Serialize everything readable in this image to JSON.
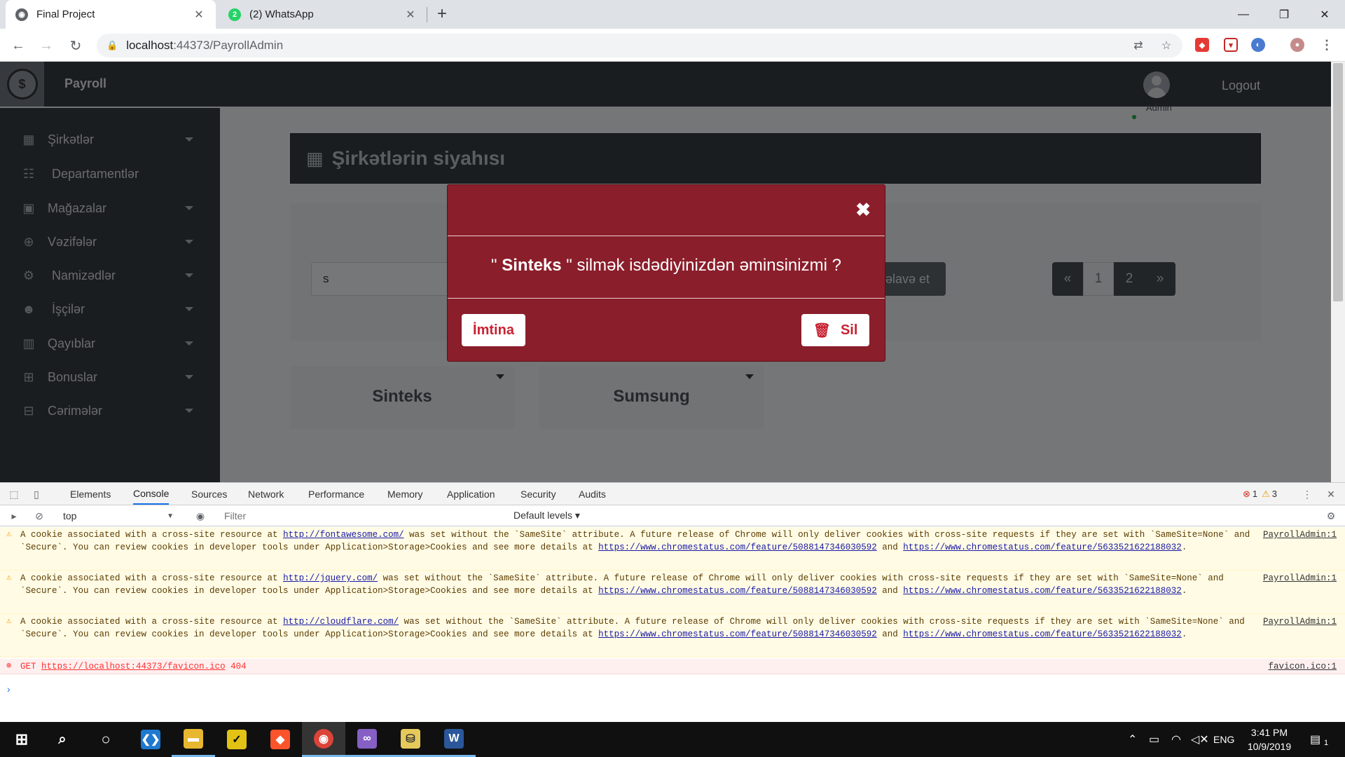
{
  "browser": {
    "tabs": [
      {
        "title": "Final Project",
        "active": true,
        "icon": "globe-icon"
      },
      {
        "title": "(2) WhatsApp",
        "active": false,
        "icon": "whatsapp-icon",
        "badge": "2"
      }
    ],
    "url_host": "localhost",
    "url_path": ":44373/PayrollAdmin"
  },
  "app": {
    "brand": "Payroll",
    "user_name": "Admin",
    "logout": "Logout",
    "sidebar": [
      {
        "label": "Şirkətlər",
        "icon": "building-icon",
        "caret": true
      },
      {
        "label": "Departamentlər",
        "icon": "sitemap-icon",
        "caret": false
      },
      {
        "label": "Mağazalar",
        "icon": "shopping-bag-icon",
        "caret": true
      },
      {
        "label": "Vəzifələr",
        "icon": "crosshairs-icon",
        "caret": true
      },
      {
        "label": "Namizədlər",
        "icon": "users-cog-icon",
        "caret": true
      },
      {
        "label": "İşçilər",
        "icon": "users-icon",
        "caret": true
      },
      {
        "label": "Qayıblar",
        "icon": "chart-bar-icon",
        "caret": true
      },
      {
        "label": "Bonuslar",
        "icon": "plus-square-icon",
        "caret": true
      },
      {
        "label": "Cərimələr",
        "icon": "minus-square-icon",
        "caret": true
      }
    ],
    "page_title": "Şirkətlərin siyahısı",
    "search_value": "s",
    "add_button": "əlavə et",
    "pagination": [
      "«",
      "1",
      "2",
      "»"
    ],
    "current_page": "1",
    "companies": [
      "Sinteks",
      "Sumsung"
    ]
  },
  "modal": {
    "quote_open": "\" ",
    "company": "Sinteks",
    "message_rest": " \" silmək isdədiyinizdən əminsinizmi ?",
    "cancel": "İmtina",
    "delete": "Sil"
  },
  "devtools": {
    "tabs": [
      "Elements",
      "Console",
      "Sources",
      "Network",
      "Performance",
      "Memory",
      "Application",
      "Security",
      "Audits"
    ],
    "active_tab": "Console",
    "error_count": "1",
    "warning_count": "3",
    "context": "top",
    "filter_placeholder": "Filter",
    "levels": "Default levels ▾",
    "messages": [
      {
        "level": "warning",
        "pre": "A cookie associated with a cross-site resource at ",
        "link": "http://fontawesome.com/",
        "post": " was set without the `SameSite` attribute. A future release of Chrome will only deliver cookies with cross-site requests if they are set with `SameSite=None` and `Secure`. You can review cookies in developer tools under Application>Storage>Cookies and see more details at ",
        "link2": "https://www.chromestatus.com/feature/5088147346030592",
        "and": " and ",
        "link3": "https://www.chromestatus.com/feature/5633521622188032",
        "end": ".",
        "source": "PayrollAdmin:1"
      },
      {
        "level": "warning",
        "pre": "A cookie associated with a cross-site resource at ",
        "link": "http://jquery.com/",
        "post": " was set without the `SameSite` attribute. A future release of Chrome will only deliver cookies with cross-site requests if they are set with `SameSite=None` and `Secure`. You can review cookies in developer tools under Application>Storage>Cookies and see more details at ",
        "link2": "https://www.chromestatus.com/feature/5088147346030592",
        "and": " and ",
        "link3": "https://www.chromestatus.com/feature/5633521622188032",
        "end": ".",
        "source": "PayrollAdmin:1"
      },
      {
        "level": "warning",
        "pre": "A cookie associated with a cross-site resource at ",
        "link": "http://cloudflare.com/",
        "post": " was set without the `SameSite` attribute. A future release of Chrome will only deliver cookies with cross-site requests if they are set with `SameSite=None` and `Secure`. You can review cookies in developer tools under Application>Storage>Cookies and see more details at ",
        "link2": "https://www.chromestatus.com/feature/5088147346030592",
        "and": " and ",
        "link3": "https://www.chromestatus.com/feature/5633521622188032",
        "end": ".",
        "source": "PayrollAdmin:1"
      }
    ],
    "error": {
      "method": "GET",
      "url": "https://localhost:44373/favicon.ico",
      "status": "404",
      "source": "favicon.ico:1"
    }
  },
  "taskbar": {
    "apps": [
      "windows-start-icon",
      "search-icon",
      "cortana-icon",
      "vscode-icon",
      "file-explorer-icon",
      "norton-icon",
      "brave-icon",
      "chrome-icon",
      "visual-studio-icon",
      "sql-icon",
      "word-icon"
    ],
    "language": "ENG",
    "time": "3:41 PM",
    "date": "10/9/2019",
    "notification_count": "1"
  },
  "colors": {
    "modal_bg": "#8b1e2b",
    "danger_text": "#c82333",
    "app_dark": "#343a40",
    "accent": "#1a73e8"
  }
}
